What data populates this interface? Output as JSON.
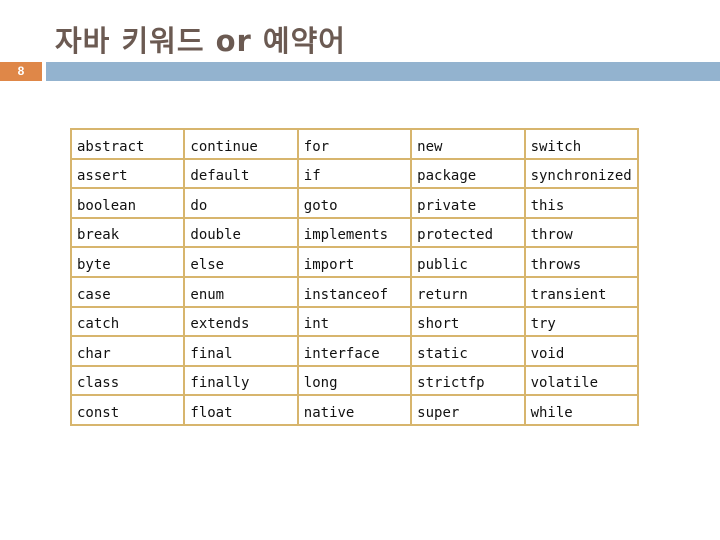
{
  "slide": {
    "title": "자바 키워드 or 예약어",
    "page_number": "8"
  },
  "colors": {
    "title": "#6b5a52",
    "page_number_bg": "#df8748",
    "header_bar": "#93b3cf",
    "table_border": "#d7b56d"
  },
  "keywords_table": {
    "rows": [
      [
        "abstract",
        "continue",
        "for",
        "new",
        "switch"
      ],
      [
        "assert",
        "default",
        "if",
        "package",
        "synchronized"
      ],
      [
        "boolean",
        "do",
        "goto",
        "private",
        "this"
      ],
      [
        "break",
        "double",
        "implements",
        "protected",
        "throw"
      ],
      [
        "byte",
        "else",
        "import",
        "public",
        "throws"
      ],
      [
        "case",
        "enum",
        "instanceof",
        "return",
        "transient"
      ],
      [
        "catch",
        "extends",
        "int",
        "short",
        "try"
      ],
      [
        "char",
        "final",
        "interface",
        "static",
        "void"
      ],
      [
        "class",
        "finally",
        "long",
        "strictfp",
        "volatile"
      ],
      [
        "const",
        "float",
        "native",
        "super",
        "while"
      ]
    ]
  }
}
